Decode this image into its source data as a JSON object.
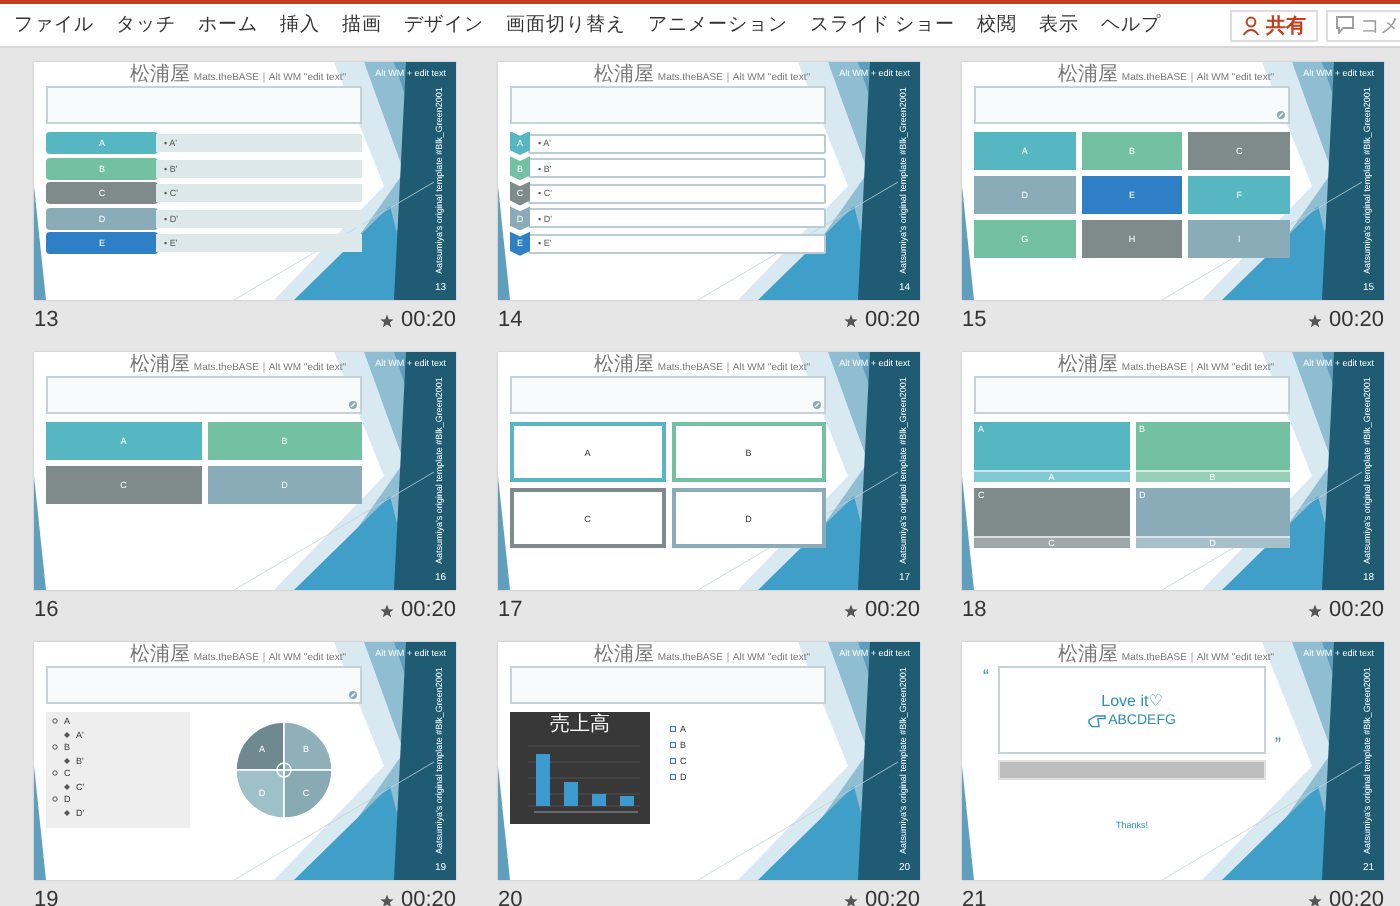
{
  "menu": [
    {
      "label": "ファイル"
    },
    {
      "label": "タッチ"
    },
    {
      "label": "ホーム"
    },
    {
      "label": "挿入"
    },
    {
      "label": "描画"
    },
    {
      "label": "デザイン"
    },
    {
      "label": "画面切り替え"
    },
    {
      "label": "アニメーション"
    },
    {
      "label": "スライド ショー"
    },
    {
      "label": "校閲"
    },
    {
      "label": "表示"
    },
    {
      "label": "ヘルプ"
    }
  ],
  "share_button": {
    "label": "共有"
  },
  "comment_button": {
    "label": "コメ"
  },
  "slides": [
    {
      "number": "13",
      "timing": "00:20",
      "header": "松浦屋 Mats.theBASE｜Alt WM \"edit text\"",
      "watermark": "Alt WM + edit text",
      "side_text": "Aatsumiya's original template #Blk_Green2001",
      "footer_number": "13",
      "kind": "bars",
      "title_icon": false,
      "items": [
        {
          "label": "A",
          "text": "• A'",
          "color": "#56b7c3"
        },
        {
          "label": "B",
          "text": "• B'",
          "color": "#74c0a2"
        },
        {
          "label": "C",
          "text": "• C'",
          "color": "#7f8b8b"
        },
        {
          "label": "D",
          "text": "• D'",
          "color": "#8aabb8"
        },
        {
          "label": "E",
          "text": "• E'",
          "color": "#2f7fc6"
        }
      ]
    },
    {
      "number": "14",
      "timing": "00:20",
      "header": "松浦屋 Mats.theBASE｜Alt WM \"edit text\"",
      "watermark": "Alt WM + edit text",
      "side_text": "Aatsumiya's original template #Blk_Green2001",
      "footer_number": "14",
      "kind": "chevrons",
      "title_icon": false,
      "items": [
        {
          "label": "A",
          "text": "• A'",
          "color": "#56b7c3"
        },
        {
          "label": "B",
          "text": "• B'",
          "color": "#74c0a2"
        },
        {
          "label": "C",
          "text": "• C'",
          "color": "#7f8b8b"
        },
        {
          "label": "D",
          "text": "• D'",
          "color": "#8aabb8"
        },
        {
          "label": "E",
          "text": "• E'",
          "color": "#2f7fc6"
        }
      ]
    },
    {
      "number": "15",
      "timing": "00:20",
      "header": "松浦屋 Mats.theBASE｜Alt WM \"edit text\"",
      "watermark": "Alt WM + edit text",
      "side_text": "Aatsumiya's original template #Blk_Green2001",
      "footer_number": "15",
      "kind": "tiles",
      "title_icon": true,
      "items": [
        {
          "label": "A",
          "color": "#56b7c3"
        },
        {
          "label": "B",
          "color": "#74c0a2"
        },
        {
          "label": "C",
          "color": "#7f8b8b"
        },
        {
          "label": "D",
          "color": "#8aabb8"
        },
        {
          "label": "E",
          "color": "#2f7fc6"
        },
        {
          "label": "F",
          "color": "#56b7c3"
        },
        {
          "label": "G",
          "color": "#74c0a2"
        },
        {
          "label": "H",
          "color": "#7f8b8b"
        },
        {
          "label": "I",
          "color": "#8aabb8"
        }
      ]
    },
    {
      "number": "16",
      "timing": "00:20",
      "header": "松浦屋 Mats.theBASE｜Alt WM \"edit text\"",
      "watermark": "Alt WM + edit text",
      "side_text": "Aatsumiya's original template #Blk_Green2001",
      "footer_number": "16",
      "kind": "tiles",
      "title_icon": true,
      "items": [
        {
          "label": "A",
          "color": "#56b7c3"
        },
        {
          "label": "B",
          "color": "#74c0a2"
        },
        {
          "label": "C",
          "color": "#7f8b8b"
        },
        {
          "label": "D",
          "color": "#8aabb8"
        }
      ]
    },
    {
      "number": "17",
      "timing": "00:20",
      "header": "松浦屋 Mats.theBASE｜Alt WM \"edit text\"",
      "watermark": "Alt WM + edit text",
      "side_text": "Aatsumiya's original template #Blk_Green2001",
      "footer_number": "17",
      "kind": "outlined",
      "title_icon": true,
      "items": [
        {
          "label": "A",
          "color": "#56b7c3"
        },
        {
          "label": "B",
          "color": "#74c0a2"
        },
        {
          "label": "C",
          "color": "#7f8b8b"
        },
        {
          "label": "D",
          "color": "#8aabb8"
        }
      ]
    },
    {
      "number": "18",
      "timing": "00:20",
      "header": "松浦屋 Mats.theBASE｜Alt WM \"edit text\"",
      "watermark": "Alt WM + edit text",
      "side_text": "Aatsumiya's original template #Blk_Green2001",
      "footer_number": "18",
      "kind": "labeled",
      "title_icon": false,
      "items": [
        {
          "label": "A",
          "caption": "A",
          "color": "#56b7c3"
        },
        {
          "label": "B",
          "caption": "B",
          "color": "#74c0a2"
        },
        {
          "label": "C",
          "caption": "C",
          "color": "#7f8b8b"
        },
        {
          "label": "D",
          "caption": "D",
          "color": "#8aabb8"
        }
      ]
    },
    {
      "number": "19",
      "timing": "00:20",
      "header": "松浦屋 Mats.theBASE｜Alt WM \"edit text\"",
      "watermark": "Alt WM + edit text",
      "side_text": "Aatsumiya's original template #Blk_Green2001",
      "footer_number": "19",
      "kind": "outline",
      "title_icon": true,
      "outline": [
        {
          "text": "A",
          "children": [
            {
              "text": "A'"
            }
          ]
        },
        {
          "text": "B",
          "children": [
            {
              "text": "B'"
            }
          ]
        },
        {
          "text": "C",
          "children": [
            {
              "text": "C'"
            }
          ]
        },
        {
          "text": "D",
          "children": [
            {
              "text": "D'"
            }
          ]
        }
      ],
      "segments": [
        {
          "label": "A",
          "color": "#6e8a90"
        },
        {
          "label": "B",
          "color": "#8fb0b9"
        },
        {
          "label": "D",
          "color": "#9ec0c8"
        },
        {
          "label": "C",
          "color": "#88aab3"
        }
      ]
    },
    {
      "number": "20",
      "timing": "00:20",
      "header": "松浦屋 Mats.theBASE｜Alt WM \"edit text\"",
      "watermark": "Alt WM + edit text",
      "side_text": "Aatsumiya's original template #Blk_Green2001",
      "footer_number": "20",
      "kind": "chart",
      "title_icon": false,
      "chart_title": "売上高",
      "items": [
        {
          "text": "A"
        },
        {
          "text": "B"
        },
        {
          "text": "C"
        },
        {
          "text": "D"
        }
      ]
    },
    {
      "number": "21",
      "timing": "00:20",
      "header": "松浦屋 Mats.theBASE｜Alt WM \"edit text\"",
      "watermark": "Alt WM + edit text",
      "side_text": "Aatsumiya's original template #Blk_Green2001",
      "footer_number": "21",
      "kind": "quote",
      "title_icon": false,
      "open_quote": "“",
      "close_quote": "”",
      "headline": "Love it♡",
      "subline": "ABCDEFG",
      "footer": "Thanks!"
    }
  ]
}
